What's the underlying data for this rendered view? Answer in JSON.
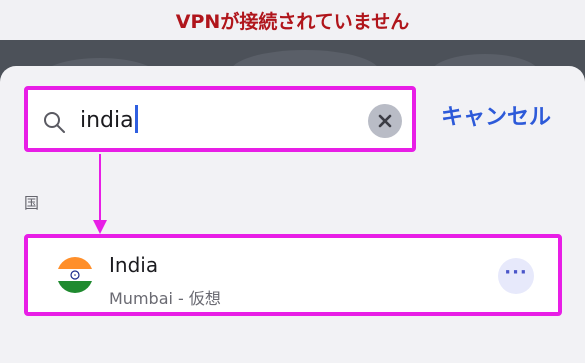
{
  "status": {
    "text": "VPNが接続されていません",
    "color": "#b0151b"
  },
  "search": {
    "value": "india",
    "cancel_label": "キャンセル",
    "icons": {
      "search": "search-icon",
      "clear": "close-icon"
    }
  },
  "results": {
    "section_label": "国",
    "items": [
      {
        "name": "India",
        "subtitle": "Mumbai - 仮想",
        "flag": "india-flag-icon",
        "more_icon": "ellipsis-icon"
      }
    ]
  },
  "highlight_color": "#e81ee6",
  "accent_color": "#2d5ad9"
}
